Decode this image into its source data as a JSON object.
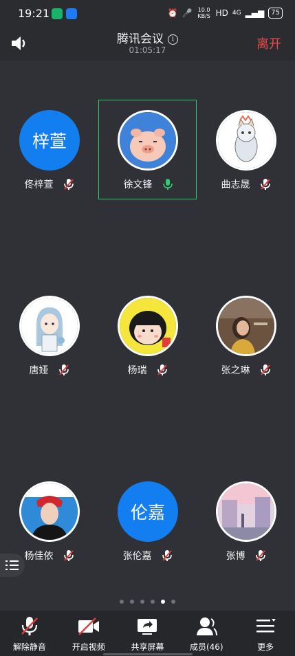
{
  "status_bar": {
    "time": "19:21",
    "network_speed": "10.0 KB/S",
    "hd_label": "HD",
    "signal_label": "4G",
    "battery_level": "75"
  },
  "header": {
    "title": "腾讯会议",
    "elapsed_time": "01:05:17",
    "leave_label": "离开"
  },
  "participants": [
    {
      "name": "佟梓萱",
      "avatar_text": "梓萱",
      "avatar_type": "text",
      "avatar_color": "#137ef0",
      "mic_state": "muted",
      "active_speaker": false
    },
    {
      "name": "徐文锋",
      "avatar_type": "image",
      "avatar_desc": "pig-cartoon",
      "mic_state": "active",
      "active_speaker": true
    },
    {
      "name": "曲志晟",
      "avatar_type": "image",
      "avatar_desc": "cat-illustration",
      "mic_state": "muted",
      "active_speaker": false
    },
    {
      "name": "唐娅",
      "avatar_type": "image",
      "avatar_desc": "anime-girl",
      "mic_state": "muted",
      "active_speaker": false
    },
    {
      "name": "杨瑞",
      "avatar_type": "image",
      "avatar_desc": "cartoon-girl",
      "mic_state": "muted",
      "active_speaker": false
    },
    {
      "name": "张之琳",
      "avatar_type": "image",
      "avatar_desc": "photo-girl",
      "mic_state": "muted",
      "active_speaker": false
    },
    {
      "name": "杨佳依",
      "avatar_type": "image",
      "avatar_desc": "photo-man",
      "mic_state": "muted",
      "active_speaker": false
    },
    {
      "name": "张伦嘉",
      "avatar_text": "伦嘉",
      "avatar_type": "text",
      "avatar_color": "#137ef0",
      "mic_state": "muted",
      "active_speaker": false
    },
    {
      "name": "张博",
      "avatar_type": "image",
      "avatar_desc": "street-painting",
      "mic_state": "muted",
      "active_speaker": false
    }
  ],
  "pagination": {
    "total_pages": 6,
    "current_page": 5
  },
  "toolbar": {
    "unmute_label": "解除静音",
    "video_label": "开启视频",
    "share_label": "共享屏幕",
    "members_label": "成员(46)",
    "more_label": "更多"
  },
  "colors": {
    "background": "#2f3136",
    "leave": "#f04b4b",
    "active_border": "#2ecc71",
    "avatar_blue": "#137ef0",
    "mic_muted": "#e23c3c",
    "mic_active": "#2ecc71"
  }
}
